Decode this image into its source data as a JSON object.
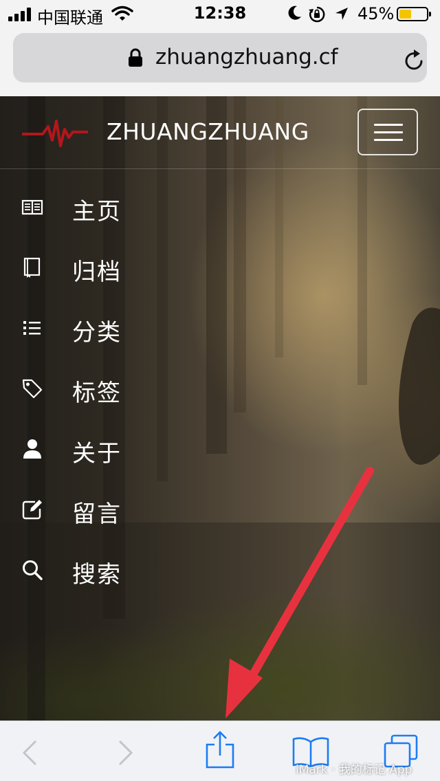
{
  "status_bar": {
    "carrier": "中国联通",
    "time": "12:38",
    "battery_percent": "45%",
    "battery_level": 0.45,
    "icons": [
      "signal-icon",
      "wifi-icon",
      "moon-icon",
      "rotation-lock-icon",
      "location-arrow-icon",
      "battery-icon"
    ]
  },
  "browser": {
    "url": "zhuangzhuang.cf",
    "icons": [
      "lock-icon",
      "reload-icon"
    ]
  },
  "site": {
    "title": "ZHUANGZHUANG",
    "logo_color": "#b3161c",
    "nav": [
      {
        "label": "主页",
        "icon": "book-open-icon"
      },
      {
        "label": "归档",
        "icon": "archive-book-icon"
      },
      {
        "label": "分类",
        "icon": "list-icon"
      },
      {
        "label": "标签",
        "icon": "tag-icon"
      },
      {
        "label": "关于",
        "icon": "user-icon"
      },
      {
        "label": "留言",
        "icon": "edit-icon"
      },
      {
        "label": "搜索",
        "icon": "search-icon"
      }
    ]
  },
  "annotation": {
    "arrow_color": "#e8313f"
  },
  "toolbar": {
    "buttons": [
      "back-icon",
      "forward-icon",
      "share-icon",
      "bookmarks-icon",
      "tabs-icon"
    ],
    "accent_color": "#1a7cf4",
    "watermark": "iMark · 我的标记 App"
  }
}
